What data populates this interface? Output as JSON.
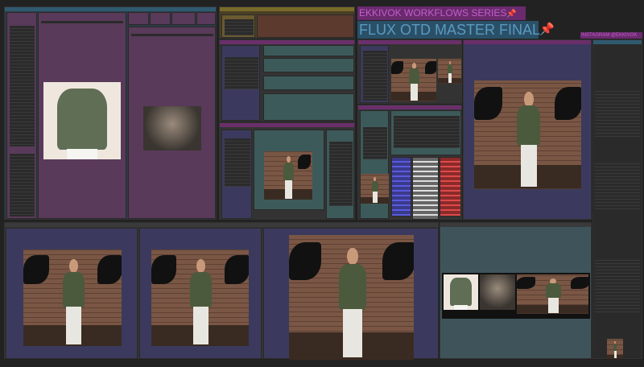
{
  "banners": {
    "series": "EKKIVOK WORKFLOWS SERIES",
    "title": "FLUX OTD MASTER FINAL",
    "instagram": "INSTAGRAM @EKKIVOK",
    "pin": "📌"
  },
  "colors": {
    "canvas": "#222222",
    "purple_node": "#593a5a",
    "blue_group": "#3b3a5e",
    "teal_node": "#3d5a5a",
    "gold_group": "#6e5a2a"
  }
}
